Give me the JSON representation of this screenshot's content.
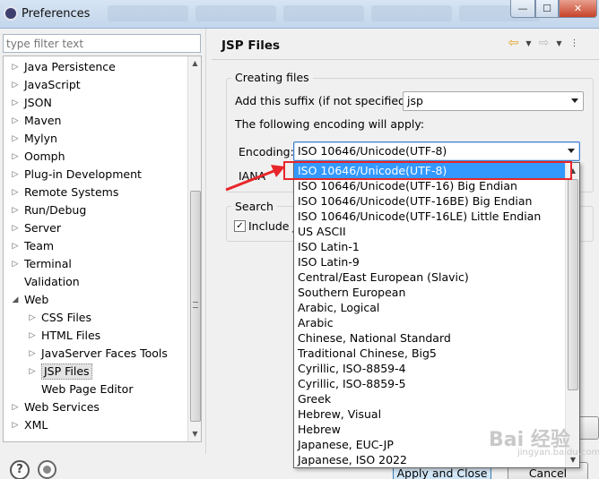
{
  "window": {
    "title": "Preferences",
    "min_glyph": "—",
    "max_glyph": "☐",
    "close_glyph": "✕"
  },
  "sidebar": {
    "filter_placeholder": "type filter text",
    "items": [
      {
        "label": "Java Persistence",
        "depth": 0,
        "expander": "collapsed"
      },
      {
        "label": "JavaScript",
        "depth": 0,
        "expander": "collapsed"
      },
      {
        "label": "JSON",
        "depth": 0,
        "expander": "collapsed"
      },
      {
        "label": "Maven",
        "depth": 0,
        "expander": "collapsed"
      },
      {
        "label": "Mylyn",
        "depth": 0,
        "expander": "collapsed"
      },
      {
        "label": "Oomph",
        "depth": 0,
        "expander": "collapsed"
      },
      {
        "label": "Plug-in Development",
        "depth": 0,
        "expander": "collapsed"
      },
      {
        "label": "Remote Systems",
        "depth": 0,
        "expander": "collapsed"
      },
      {
        "label": "Run/Debug",
        "depth": 0,
        "expander": "collapsed"
      },
      {
        "label": "Server",
        "depth": 0,
        "expander": "collapsed"
      },
      {
        "label": "Team",
        "depth": 0,
        "expander": "collapsed"
      },
      {
        "label": "Terminal",
        "depth": 0,
        "expander": "collapsed"
      },
      {
        "label": "Validation",
        "depth": 0,
        "expander": "none"
      },
      {
        "label": "Web",
        "depth": 0,
        "expander": "expanded"
      },
      {
        "label": "CSS Files",
        "depth": 1,
        "expander": "collapsed"
      },
      {
        "label": "HTML Files",
        "depth": 1,
        "expander": "collapsed"
      },
      {
        "label": "JavaServer Faces Tools",
        "depth": 1,
        "expander": "collapsed"
      },
      {
        "label": "JSP Files",
        "depth": 1,
        "expander": "collapsed",
        "selected": true
      },
      {
        "label": "Web Page Editor",
        "depth": 1,
        "expander": "none"
      },
      {
        "label": "Web Services",
        "depth": 0,
        "expander": "collapsed"
      },
      {
        "label": "XML",
        "depth": 0,
        "expander": "collapsed"
      }
    ]
  },
  "page": {
    "title": "JSP Files",
    "creating_files": {
      "group_label": "Creating files",
      "suffix_label": "Add this suffix (if not specified):",
      "suffix_value": "jsp",
      "following_label": "The following encoding will apply:",
      "encoding_label": "Encoding:",
      "encoding_value": "ISO 10646/Unicode(UTF-8)",
      "iana_label": "IANA"
    },
    "search": {
      "group_label": "Search",
      "include_label": "Include J",
      "include_checked": true
    },
    "buttons": {
      "apply_defaults": "",
      "apply_close": "Apply and Close",
      "cancel": "Cancel"
    }
  },
  "encoding_dropdown": {
    "selected_index": 0,
    "options": [
      "ISO 10646/Unicode(UTF-8)",
      "ISO 10646/Unicode(UTF-16) Big Endian",
      "ISO 10646/Unicode(UTF-16BE) Big Endian",
      "ISO 10646/Unicode(UTF-16LE) Little Endian",
      "US ASCII",
      "ISO Latin-1",
      "ISO Latin-9",
      "Central/East European (Slavic)",
      "Southern European",
      "Arabic, Logical",
      "Arabic",
      "Chinese, National Standard",
      "Traditional Chinese, Big5",
      "Cyrillic, ISO-8859-4",
      "Cyrillic, ISO-8859-5",
      "Greek",
      "Hebrew, Visual",
      "Hebrew",
      "Japanese, EUC-JP",
      "Japanese, ISO 2022"
    ]
  },
  "annotation": {
    "highlight_color": "#e8262a"
  },
  "watermark": {
    "text": "Bai 经验",
    "sub": "jingyan.baidu.com"
  },
  "colors": {
    "selection": "#3399ff",
    "accent_border": "#3f7fd1"
  }
}
